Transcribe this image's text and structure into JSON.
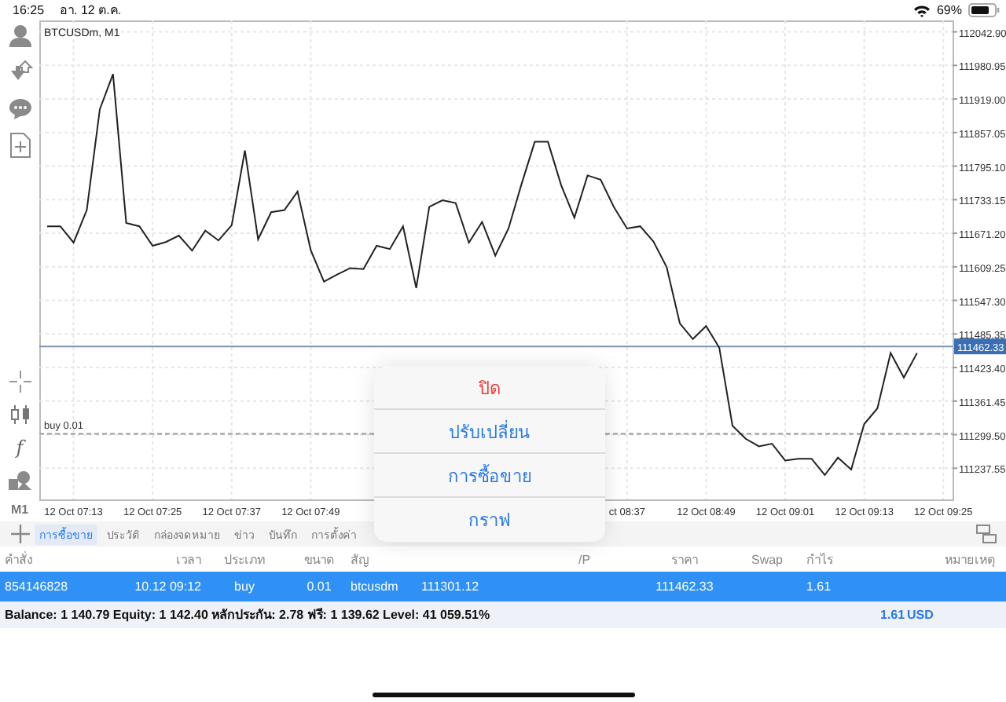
{
  "status_bar": {
    "time": "16:25",
    "date": "อา. 12 ต.ค.",
    "battery": "69%"
  },
  "toolbar": {
    "function_label": "f",
    "timeframe": "M1"
  },
  "chart": {
    "title": "BTCUSDm, M1",
    "chart_data": {
      "type": "line",
      "ylim": [
        111180,
        112064
      ],
      "grid": true,
      "ref_lines": [
        {
          "axis": "y",
          "value": 111462.33,
          "label": "111462.33"
        },
        {
          "axis": "y",
          "value": 111301.12,
          "label": "buy 0.01"
        }
      ],
      "yticks": [
        {
          "value": 112042.9,
          "label": "112042.90"
        },
        {
          "value": 111980.95,
          "label": "111980.95"
        },
        {
          "value": 111919,
          "label": "111919.00"
        },
        {
          "value": 111857.05,
          "label": "111857.05"
        },
        {
          "value": 111795.1,
          "label": "111795.10"
        },
        {
          "value": 111733.15,
          "label": "111733.15"
        },
        {
          "value": 111671.2,
          "label": "111671.20"
        },
        {
          "value": 111609.25,
          "label": "111609.25"
        },
        {
          "value": 111547.3,
          "label": "111547.30"
        },
        {
          "value": 111485.35,
          "label": "111485.35"
        },
        {
          "value": 111423.4,
          "label": "111423.40"
        },
        {
          "value": 111361.45,
          "label": "111361.45"
        },
        {
          "value": 111299.5,
          "label": "111299.50"
        },
        {
          "value": 111237.55,
          "label": "111237.55"
        }
      ],
      "categories": [
        null,
        null,
        "12 Oct 07:13",
        null,
        null,
        null,
        null,
        null,
        "12 Oct 07:25",
        null,
        null,
        null,
        null,
        null,
        "12 Oct 07:37",
        null,
        null,
        null,
        null,
        null,
        "12 Oct 07:49",
        null,
        null,
        null,
        null,
        null,
        null,
        null,
        null,
        null,
        null,
        null,
        null,
        null,
        null,
        null,
        null,
        null,
        null,
        null,
        null,
        null,
        null,
        null,
        "ct 08:37",
        null,
        null,
        null,
        null,
        null,
        "12 Oct 08:49",
        null,
        null,
        null,
        null,
        null,
        "12 Oct 09:01",
        null,
        null,
        null,
        null,
        null,
        "12 Oct 09:13",
        null,
        null,
        null,
        null,
        null,
        "12 Oct 09:25"
      ],
      "series": [
        {
          "color": "#222222",
          "values": [
            111684,
            111684,
            111654,
            111714,
            111900,
            111965,
            111690,
            111684,
            111648,
            111655,
            111667,
            111639,
            111676,
            111658,
            111686,
            111824,
            111660,
            111710,
            111714,
            111748,
            111640,
            111582,
            111595,
            111607,
            111605,
            111648,
            111642,
            111684,
            111570,
            111720,
            111732,
            111727,
            111654,
            111692,
            111630,
            111680,
            111762,
            111840,
            111840,
            111760,
            111700,
            111778,
            111770,
            111720,
            111680,
            111684,
            111656,
            111609,
            111505,
            111476,
            111500,
            111460,
            111316,
            111292,
            111278,
            111283,
            111252,
            111255,
            111255,
            111225,
            111257,
            111235,
            111319,
            111348,
            111450,
            111405,
            111450,
            null,
            null
          ]
        }
      ]
    }
  },
  "action_sheet": [
    {
      "label": "ปิด",
      "kind": "destructive"
    },
    {
      "label": "ปรับเปลี่ยน",
      "kind": "action"
    },
    {
      "label": "การซื้อขาย",
      "kind": "action"
    },
    {
      "label": "กราฟ",
      "kind": "action"
    }
  ],
  "tabs": [
    {
      "label": "การซื้อขาย",
      "selected": true
    },
    {
      "label": "ประวัติ",
      "selected": false
    },
    {
      "label": "กล่องจดหมาย",
      "selected": false
    },
    {
      "label": "ข่าว",
      "selected": false
    },
    {
      "label": "บันทึก",
      "selected": false
    },
    {
      "label": "การตั้งค่า",
      "selected": false
    }
  ],
  "table": {
    "columns": [
      {
        "label": "คำสั่ง"
      },
      {
        "label": "เวลา"
      },
      {
        "label": "ประเภท"
      },
      {
        "label": "ขนาด"
      },
      {
        "label": "สัญ"
      },
      {},
      {},
      {
        "label": "/P"
      },
      {
        "label": "ราคา"
      },
      {
        "label": "Swap"
      },
      {
        "label": "กำไร"
      },
      {
        "label": "หมายเหตุ"
      }
    ],
    "rows": [
      {
        "selected": true,
        "cells": [
          "854146828",
          "10.12 09:12",
          "buy",
          "0.01",
          "btcusdm",
          "111301.12",
          null,
          null,
          "111462.33",
          null,
          "1.61",
          null
        ]
      }
    ]
  },
  "summary": {
    "text": "Balance: 1 140.79 Equity: 1 142.40 หลักประกัน: 2.78 ฟรี: 1 139.62 Level: 41 059.51%",
    "profit": "1.61",
    "currency": "USD"
  }
}
